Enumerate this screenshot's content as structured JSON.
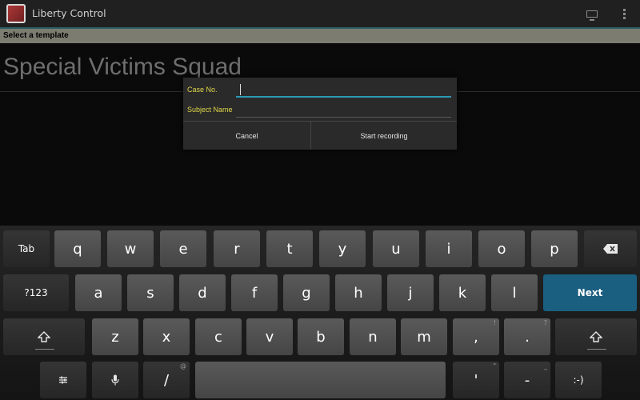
{
  "action_bar": {
    "title": "Liberty Control",
    "icons": [
      "app-logo-icon",
      "monitor-icon",
      "overflow-menu-icon"
    ]
  },
  "subheader": {
    "text": "Select a template"
  },
  "template": {
    "title": "Special Victims Squad"
  },
  "dialog": {
    "case_label": "Case No.",
    "case_value": "",
    "subject_label": "Subject Name",
    "subject_value": "",
    "cancel_label": "Cancel",
    "start_label": "Start recording"
  },
  "keyboard": {
    "row1": {
      "tab": "Tab",
      "keys": [
        "q",
        "w",
        "e",
        "r",
        "t",
        "y",
        "u",
        "i",
        "o",
        "p"
      ],
      "backspace": "backspace-icon"
    },
    "row2": {
      "numbers": "?123",
      "keys": [
        "a",
        "s",
        "d",
        "f",
        "g",
        "h",
        "j",
        "k",
        "l"
      ],
      "next": "Next"
    },
    "row3": {
      "keys": [
        "z",
        "x",
        "c",
        "v",
        "b",
        "n",
        "m"
      ],
      "comma": ",",
      "comma_alt": "!",
      "period": ".",
      "period_alt": "?",
      "shift_icon": "shift-icon"
    },
    "row4": {
      "slash": "/",
      "slash_alt": "@",
      "apostrophe": "'",
      "apostrophe_alt": "\"",
      "dash": "-",
      "dash_alt": "_",
      "smiley": ":-)",
      "settings_icon": "settings-icon",
      "mic_icon": "microphone-icon"
    }
  },
  "colors": {
    "accent": "#1b5f80",
    "label": "#e0d84a",
    "focus": "#2a9ab5"
  }
}
